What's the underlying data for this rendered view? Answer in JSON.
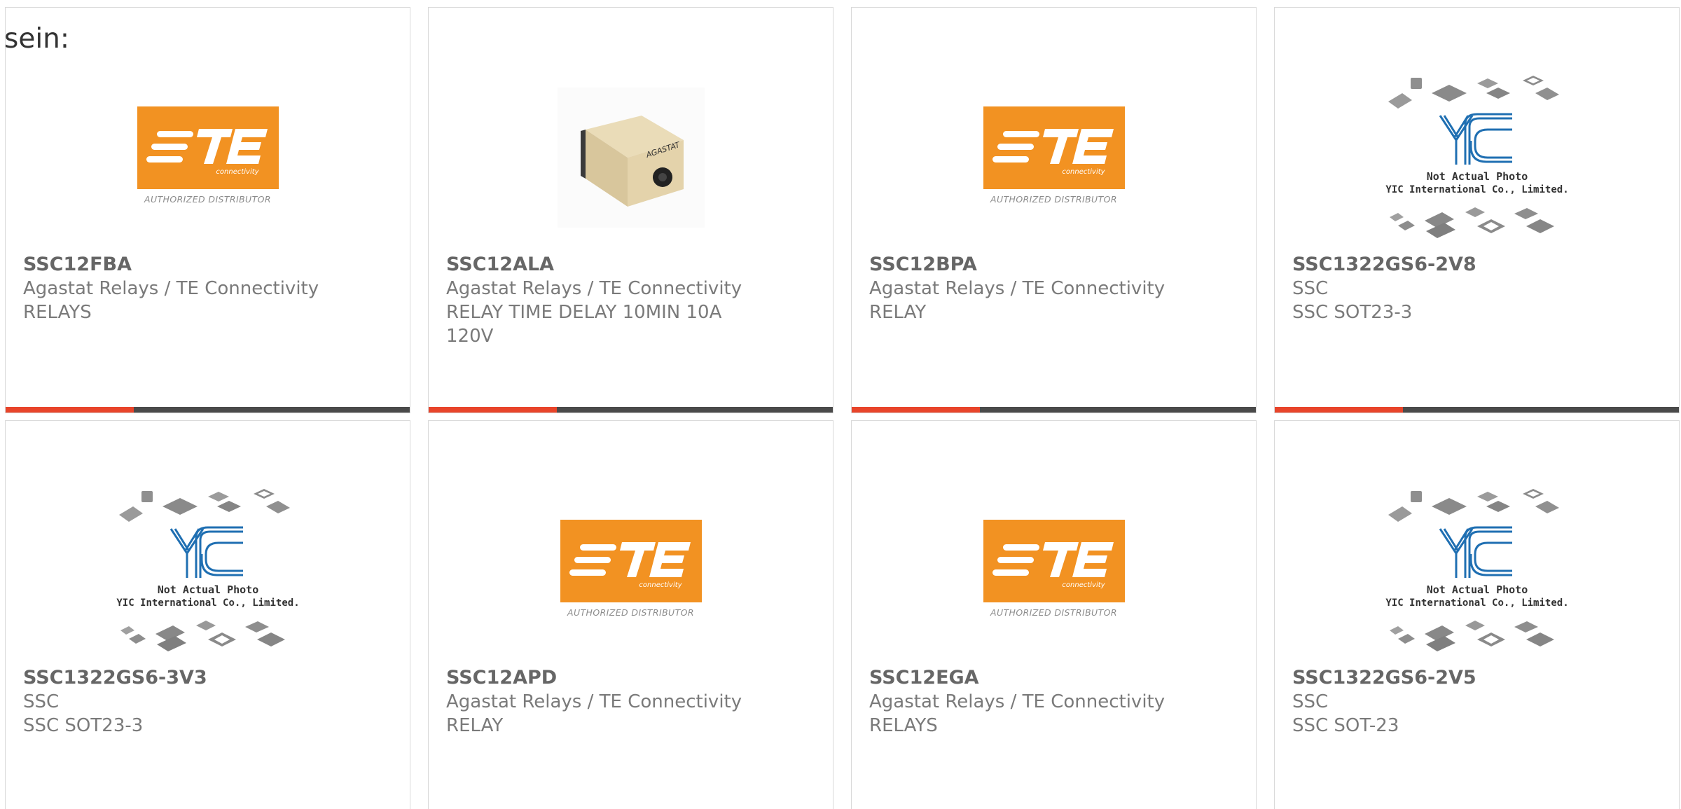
{
  "intro_text": "sein:",
  "te_logo": {
    "caption": "AUTHORIZED DISTRIBUTOR",
    "wordmark": "TE",
    "sub": "connectivity",
    "orange": "#f29222"
  },
  "yic_placeholder": {
    "line1": "Not Actual Photo",
    "line2": "YIC International Co., Limited.",
    "blue": "#1f6fb2"
  },
  "colors": {
    "accent_bar": "#e8442a",
    "dark_bar": "#4a4a4a",
    "part_number": "#666666",
    "text": "#7a7a7a",
    "border": "#d9d9d9"
  },
  "products": [
    {
      "part": "SSC12FBA",
      "maker": "Agastat Relays / TE Connectivity",
      "desc": "RELAYS",
      "image": "te-logo"
    },
    {
      "part": "SSC12ALA",
      "maker": "Agastat Relays / TE Connectivity",
      "desc": "RELAY TIME DELAY 10MIN 10A 120V",
      "image": "relay-photo"
    },
    {
      "part": "SSC12BPA",
      "maker": "Agastat Relays / TE Connectivity",
      "desc": "RELAY",
      "image": "te-logo"
    },
    {
      "part": "SSC1322GS6-2V8",
      "maker": "SSC",
      "desc": "SSC SOT23-3",
      "image": "yic-placeholder"
    },
    {
      "part": "SSC1322GS6-3V3",
      "maker": "SSC",
      "desc": "SSC SOT23-3",
      "image": "yic-placeholder"
    },
    {
      "part": "SSC12APD",
      "maker": "Agastat Relays / TE Connectivity",
      "desc": "RELAY",
      "image": "te-logo"
    },
    {
      "part": "SSC12EGA",
      "maker": "Agastat Relays / TE Connectivity",
      "desc": "RELAYS",
      "image": "te-logo"
    },
    {
      "part": "SSC1322GS6-2V5",
      "maker": "SSC",
      "desc": "SSC SOT-23",
      "image": "yic-placeholder"
    }
  ]
}
